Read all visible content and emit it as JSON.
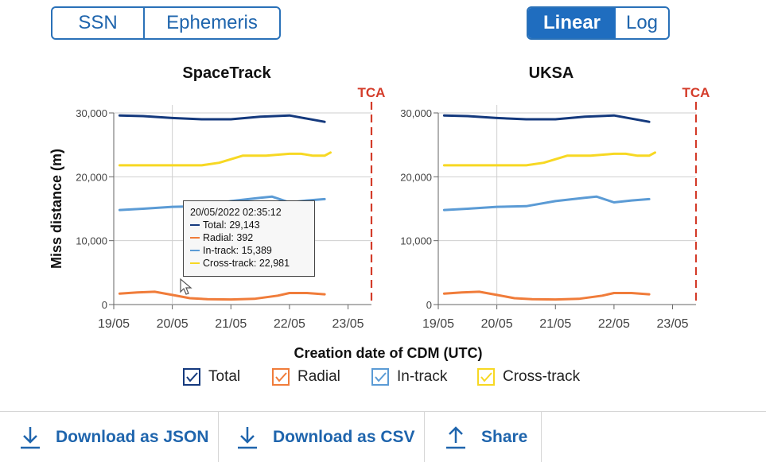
{
  "source_toggle": {
    "options": [
      "SSN",
      "Ephemeris"
    ],
    "selected": "SSN"
  },
  "scale_toggle": {
    "options": [
      "Linear",
      "Log"
    ],
    "selected": "Linear"
  },
  "colors": {
    "total": "#14397d",
    "radial": "#f07c3a",
    "intrack": "#5b9bd5",
    "crosstrack": "#f7d823",
    "tca": "#d43c2a",
    "accent": "#1f6dbf"
  },
  "chart_data": [
    {
      "type": "line",
      "title": "SpaceTrack",
      "xlabel": "Creation date of CDM (UTC)",
      "ylabel": "Miss distance (m)",
      "xlim": [
        19.0,
        23.4
      ],
      "ylim": [
        0,
        30000
      ],
      "x_ticks": [
        "19/05",
        "20/05",
        "21/05",
        "22/05",
        "23/05"
      ],
      "y_ticks": [
        "0",
        "10,000",
        "20,000",
        "30,000"
      ],
      "tca_label": "TCA",
      "tca_x": 23.4,
      "series": [
        {
          "name": "Total",
          "x": [
            19.1,
            19.5,
            20.0,
            20.5,
            21.0,
            21.5,
            22.0,
            22.3,
            22.6
          ],
          "y": [
            29600,
            29500,
            29200,
            29000,
            29000,
            29400,
            29600,
            29100,
            28600
          ]
        },
        {
          "name": "Radial",
          "x": [
            19.1,
            19.4,
            19.7,
            20.0,
            20.3,
            20.6,
            21.0,
            21.4,
            21.8,
            22.0,
            22.3,
            22.6
          ],
          "y": [
            1700,
            1900,
            2000,
            1500,
            1000,
            850,
            800,
            900,
            1400,
            1800,
            1800,
            1600
          ]
        },
        {
          "name": "In-track",
          "x": [
            19.1,
            19.5,
            20.0,
            20.5,
            21.0,
            21.5,
            21.7,
            22.0,
            22.3,
            22.6
          ],
          "y": [
            14800,
            15000,
            15300,
            15400,
            16200,
            16700,
            16900,
            16000,
            16300,
            16500
          ]
        },
        {
          "name": "Cross-track",
          "x": [
            19.1,
            19.5,
            20.0,
            20.5,
            20.8,
            21.2,
            21.6,
            22.0,
            22.2,
            22.4,
            22.6,
            22.7
          ],
          "y": [
            21800,
            21800,
            21800,
            21800,
            22200,
            23300,
            23300,
            23600,
            23600,
            23300,
            23300,
            23800
          ]
        }
      ],
      "tooltip": {
        "date": "20/05/2022 02:35:12",
        "lines": [
          "Total: 29,143",
          "Radial: 392",
          "In-track: 15,389",
          "Cross-track: 22,981"
        ]
      }
    },
    {
      "type": "line",
      "title": "UKSA",
      "xlabel": "",
      "ylabel": "",
      "xlim": [
        19.0,
        23.4
      ],
      "ylim": [
        0,
        30000
      ],
      "x_ticks": [
        "19/05",
        "20/05",
        "21/05",
        "22/05",
        "23/05"
      ],
      "y_ticks": [
        "0",
        "10,000",
        "20,000",
        "30,000"
      ],
      "tca_label": "TCA",
      "tca_x": 23.4,
      "series": [
        {
          "name": "Total",
          "x": [
            19.1,
            19.5,
            20.0,
            20.5,
            21.0,
            21.5,
            22.0,
            22.3,
            22.6
          ],
          "y": [
            29600,
            29500,
            29200,
            29000,
            29000,
            29400,
            29600,
            29100,
            28600
          ]
        },
        {
          "name": "Radial",
          "x": [
            19.1,
            19.4,
            19.7,
            20.0,
            20.3,
            20.6,
            21.0,
            21.4,
            21.8,
            22.0,
            22.3,
            22.6
          ],
          "y": [
            1700,
            1900,
            2000,
            1500,
            1000,
            850,
            800,
            900,
            1400,
            1800,
            1800,
            1600
          ]
        },
        {
          "name": "In-track",
          "x": [
            19.1,
            19.5,
            20.0,
            20.5,
            21.0,
            21.5,
            21.7,
            22.0,
            22.3,
            22.6
          ],
          "y": [
            14800,
            15000,
            15300,
            15400,
            16200,
            16700,
            16900,
            16000,
            16300,
            16500
          ]
        },
        {
          "name": "Cross-track",
          "x": [
            19.1,
            19.5,
            20.0,
            20.5,
            20.8,
            21.2,
            21.6,
            22.0,
            22.2,
            22.4,
            22.6,
            22.7
          ],
          "y": [
            21800,
            21800,
            21800,
            21800,
            22200,
            23300,
            23300,
            23600,
            23600,
            23300,
            23300,
            23800
          ]
        }
      ]
    }
  ],
  "legend": [
    "Total",
    "Radial",
    "In-track",
    "Cross-track"
  ],
  "actions": [
    {
      "label": "Download as JSON",
      "icon": "download-icon"
    },
    {
      "label": "Download as CSV",
      "icon": "download-icon"
    },
    {
      "label": "Share",
      "icon": "upload-icon"
    }
  ]
}
